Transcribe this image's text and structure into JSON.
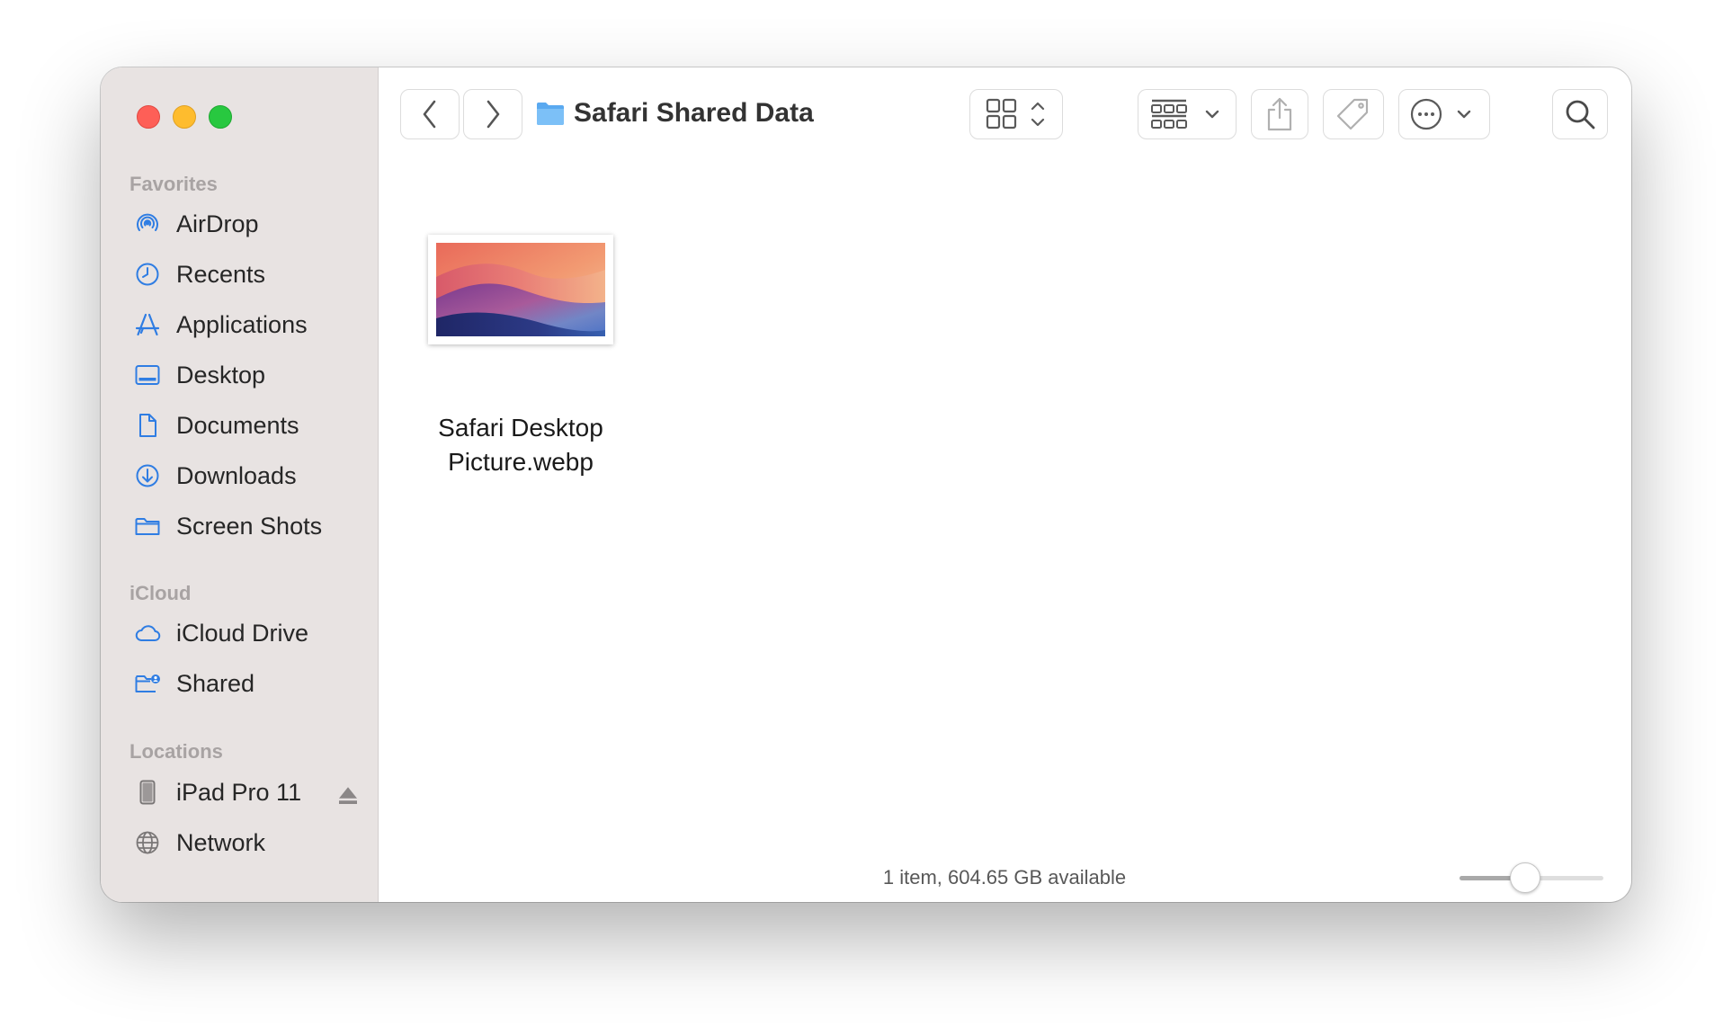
{
  "window": {
    "title": "Safari Shared Data"
  },
  "colors": {
    "accent": "#2f7de3",
    "close": "#fe5f57",
    "minimize": "#febc2e",
    "maximize": "#28c840"
  },
  "sidebar": {
    "favorites_label": "Favorites",
    "favorites": [
      {
        "label": "AirDrop",
        "icon": "airdrop-icon"
      },
      {
        "label": "Recents",
        "icon": "clock-icon"
      },
      {
        "label": "Applications",
        "icon": "applications-icon"
      },
      {
        "label": "Desktop",
        "icon": "desktop-icon"
      },
      {
        "label": "Documents",
        "icon": "document-icon"
      },
      {
        "label": "Downloads",
        "icon": "download-icon"
      },
      {
        "label": "Screen Shots",
        "icon": "folder-icon"
      }
    ],
    "icloud_label": "iCloud",
    "icloud": [
      {
        "label": "iCloud Drive",
        "icon": "cloud-icon"
      },
      {
        "label": "Shared",
        "icon": "shared-folder-icon"
      }
    ],
    "locations_label": "Locations",
    "locations": [
      {
        "label": "iPad Pro 11",
        "icon": "ipad-icon",
        "eject_icon": "eject-icon"
      },
      {
        "label": "Network",
        "icon": "globe-icon"
      }
    ]
  },
  "toolbar": {
    "back_icon": "chevron-left-icon",
    "forward_icon": "chevron-right-icon",
    "view_icon": "grid-view-icon",
    "group_icon": "group-icon",
    "share_icon": "share-icon",
    "tag_icon": "tag-icon",
    "action_icon": "more-icon",
    "search_icon": "search-icon"
  },
  "files": [
    {
      "name": "Safari Desktop Picture.webp",
      "name_line1": "Safari Desktop",
      "name_line2": "Picture.webp"
    }
  ],
  "status_bar": {
    "text": "1 item, 604.65 GB available",
    "icon_size_level": 0.45
  }
}
